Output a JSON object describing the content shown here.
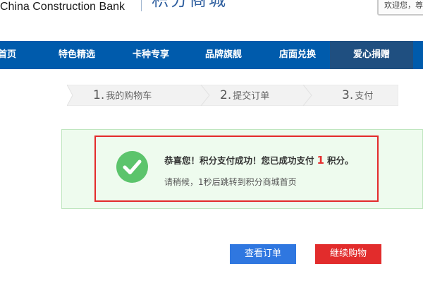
{
  "header": {
    "bank_name": "China Construction Bank",
    "mall_title": "积分商城",
    "user_box_text": "欢迎您，尊"
  },
  "nav": {
    "items": [
      {
        "label": "首页",
        "active": false
      },
      {
        "label": "特色精选",
        "active": false
      },
      {
        "label": "卡种专享",
        "active": false
      },
      {
        "label": "品牌旗舰",
        "active": false
      },
      {
        "label": "店面兑换",
        "active": false
      },
      {
        "label": "爱心捐赠",
        "active": true
      }
    ]
  },
  "steps": [
    {
      "num": "1.",
      "label": "我的购物车"
    },
    {
      "num": "2.",
      "label": "提交订单"
    },
    {
      "num": "3.",
      "label": "支付"
    }
  ],
  "result": {
    "message_prefix": "恭喜您！积分支付成功！您已成功支付",
    "amount": "1",
    "message_suffix": "积分。",
    "redirect_text": "请稍候，1秒后跳转到积分商城首页"
  },
  "buttons": {
    "view_order": "查看订单",
    "continue_shopping": "继续购物"
  },
  "colors": {
    "nav_bg": "#005bac",
    "nav_active": "#1f4f80",
    "success_green": "#5cc46c",
    "panel_bg": "#eefbee",
    "highlight_red": "#e32b2b",
    "btn_blue": "#2f77e0",
    "btn_red": "#e22c2c"
  }
}
